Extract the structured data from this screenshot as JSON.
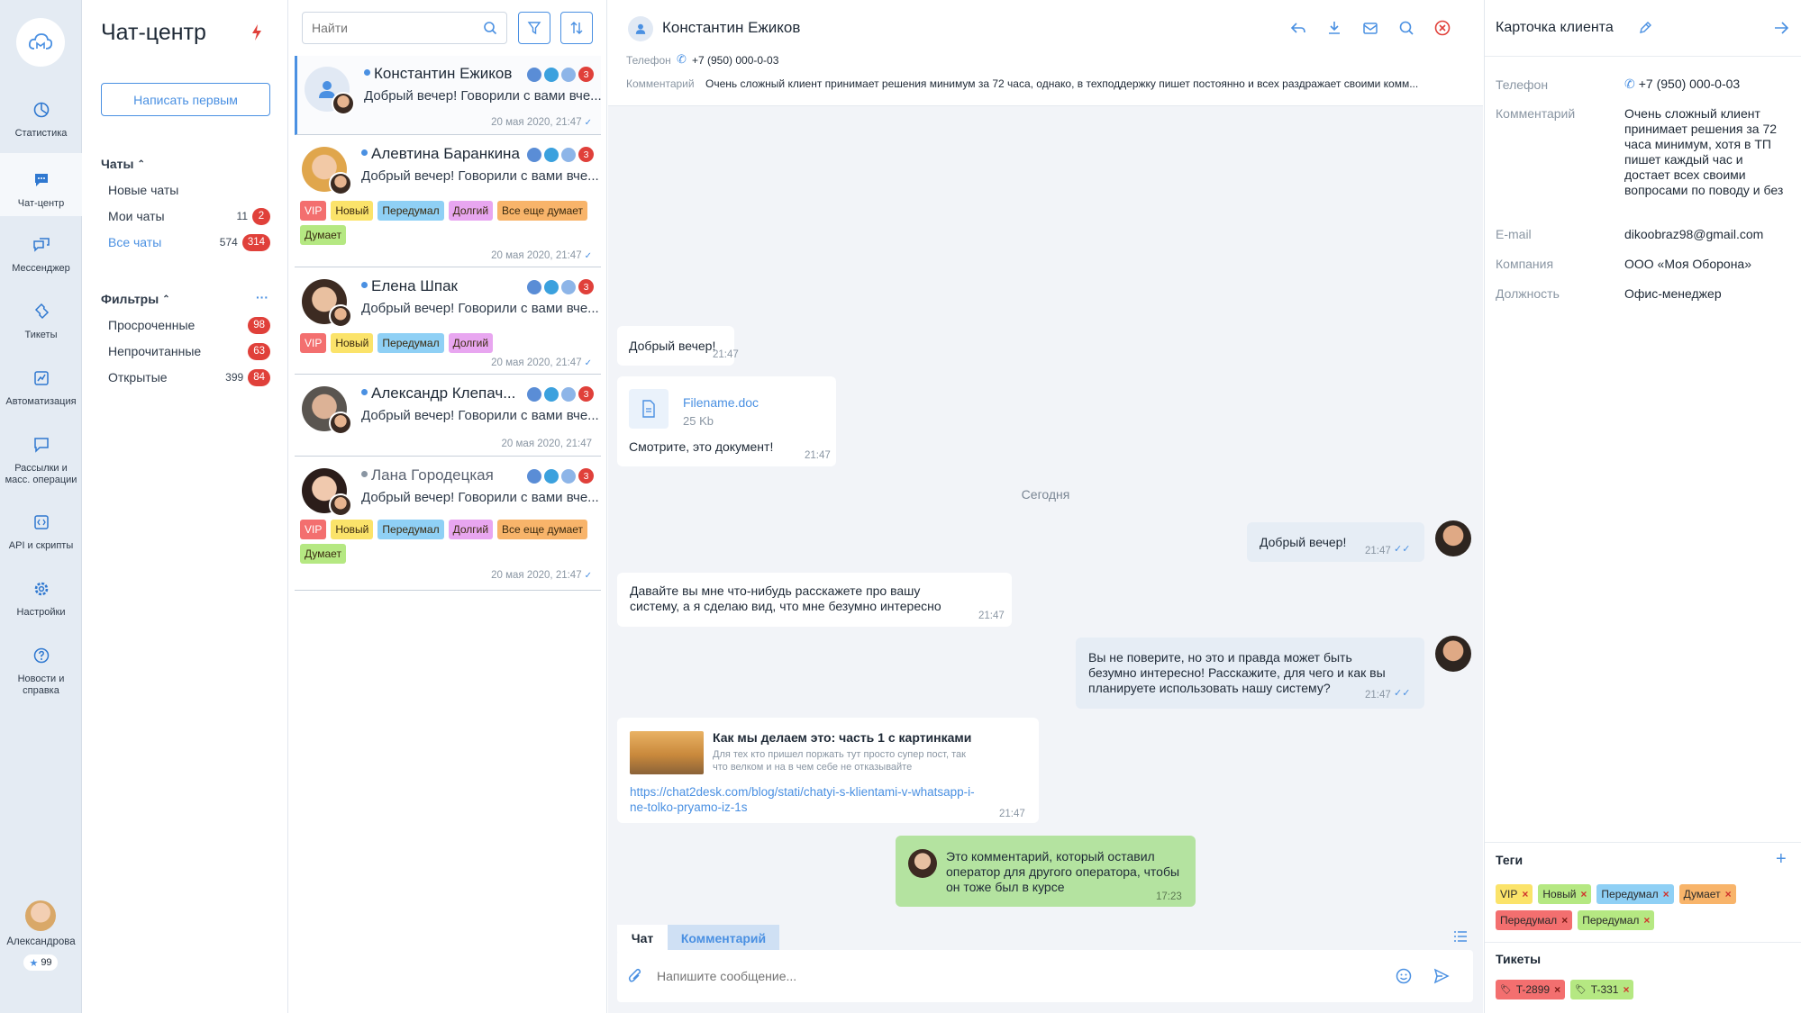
{
  "nav": {
    "items": [
      {
        "label": "Статистика",
        "icon": "chart-pie-icon"
      },
      {
        "label": "Чат-центр",
        "icon": "chat-bubble-icon"
      },
      {
        "label": "Мессенджер",
        "icon": "messenger-icon"
      },
      {
        "label": "Тикеты",
        "icon": "ticket-icon"
      },
      {
        "label": "Автоматизация",
        "icon": "automation-icon"
      },
      {
        "label": "Рассылки и масс. операции",
        "icon": "mailing-icon"
      },
      {
        "label": "API и скрипты",
        "icon": "code-icon"
      },
      {
        "label": "Настройки",
        "icon": "gear-icon"
      },
      {
        "label": "Новости и справка",
        "icon": "help-icon"
      }
    ],
    "user_name": "Александрова",
    "user_rating": "99"
  },
  "sidebar": {
    "title": "Чат-центр",
    "write_first": "Написать первым",
    "chats_header": "Чаты",
    "chat_items": [
      {
        "label": "Новые чаты",
        "count": "",
        "badge": ""
      },
      {
        "label": "Мои чаты",
        "count": "11",
        "badge": "2"
      },
      {
        "label": "Все чаты",
        "count": "574",
        "badge": "314"
      }
    ],
    "filters_header": "Фильтры",
    "filter_items": [
      {
        "label": "Просроченные",
        "count": "",
        "badge": "98"
      },
      {
        "label": "Непрочитанные",
        "count": "",
        "badge": "63"
      },
      {
        "label": "Открытые",
        "count": "399",
        "badge": "84"
      }
    ]
  },
  "list": {
    "search_placeholder": "Найти",
    "chats": [
      {
        "name": "Константин Ежиков",
        "msg": "Добрый вечер! Говорили с вами вче...",
        "time": "20 мая 2020, 21:47",
        "unread": "3"
      },
      {
        "name": "Алевтина Баранкина",
        "msg": "Добрый вечер! Говорили с вами вче...",
        "time": "20 мая 2020, 21:47",
        "unread": "3",
        "tags": [
          "VIP",
          "Новый",
          "Передумал",
          "Долгий",
          "Все еще думает",
          "Думает"
        ]
      },
      {
        "name": "Елена Шпак",
        "msg": "Добрый вечер! Говорили с вами вче...",
        "time": "20 мая 2020, 21:47",
        "unread": "3",
        "tags": [
          "VIP",
          "Новый",
          "Передумал",
          "Долгий"
        ]
      },
      {
        "name": "Александр Клепач...",
        "msg": "Добрый вечер! Говорили с вами вче...",
        "time": "20 мая 2020, 21:47",
        "unread": "3"
      },
      {
        "name": "Лана Городецкая",
        "msg": "Добрый вечер! Говорили с вами вче...",
        "time": "20 мая 2020, 21:47",
        "unread": "3",
        "tags": [
          "VIP",
          "Новый",
          "Передумал",
          "Долгий",
          "Все еще думает",
          "Думает"
        ]
      }
    ]
  },
  "header": {
    "name": "Константин Ежиков",
    "phone_label": "Телефон",
    "phone": "+7 (950) 000-0-03",
    "comment_label": "Комментарий",
    "comment": "Очень сложный клиент принимает решения минимум за 72 часа, однако, в техподдержку пишет постоянно и всех раздражает своими комм..."
  },
  "messages": {
    "m1_text": "Добрый вечер!",
    "m1_time": "21:47",
    "file_name": "Filename.doc",
    "file_size": "25 Kb",
    "m2_text": "Смотрите, это документ!",
    "m2_time": "21:47",
    "divider": "Сегодня",
    "m3_text": "Добрый вечер!",
    "m3_time": "21:47",
    "m4_text_1": "Давайте вы мне что-нибудь расскажете про вашу",
    "m4_text_2": "систему, а я сделаю вид, что мне безумно интересно",
    "m4_time": "21:47",
    "m5_text_1": "Вы не поверите, но это и правда может быть",
    "m5_text_2": "безумно интересно! Расскажите, для чего и как вы",
    "m5_text_3": "планируете использовать нашу систему?",
    "m5_time": "21:47",
    "link_title": "Как мы делаем это: часть 1 с картинками",
    "link_desc_1": "Для тех кто пришел поржать тут просто супер пост, так",
    "link_desc_2": "что велком и на в чем себе не отказывайте",
    "link_url_1": "https://chat2desk.com/blog/stati/chatyi-s-klientami-v-whatsapp-i-",
    "link_url_2": "ne-tolko-pryamo-iz-1s",
    "link_time": "21:47",
    "comment_1": "Это комментарий, который оставил",
    "comment_2": "оператор для другого оператора, чтобы",
    "comment_3": "он тоже был в курсе",
    "comment_time": "17:23"
  },
  "composer": {
    "tab_chat": "Чат",
    "tab_comment": "Комментарий",
    "placeholder": "Напишите сообщение..."
  },
  "card": {
    "title": "Карточка клиента",
    "fields": [
      {
        "label": "Телефон",
        "value": "+7 (950) 000-0-03"
      },
      {
        "label": "Комментарий",
        "value": "Очень сложный клиент принимает решения за 72 часа минимум, хотя в ТП пишет каждый час и достает всех своими вопросами по поводу и без"
      },
      {
        "label": "E-mail",
        "value": "dikoobraz98@gmail.com"
      },
      {
        "label": "Компания",
        "value": "ООО «Моя Оборона»"
      },
      {
        "label": "Должность",
        "value": "Офис-менеджер"
      }
    ],
    "tags_title": "Теги",
    "tags": [
      "VIP",
      "Новый",
      "Передумал",
      "Думает",
      "Передумал",
      "Передумал"
    ],
    "tickets_title": "Тикеты",
    "tickets": [
      "T-2899",
      "T-331"
    ]
  },
  "colors": {
    "accent": "#4a90e2",
    "danger": "#e0403a",
    "nav_bg": "#e4ebf3",
    "comment_bg": "#b4e3a0"
  }
}
